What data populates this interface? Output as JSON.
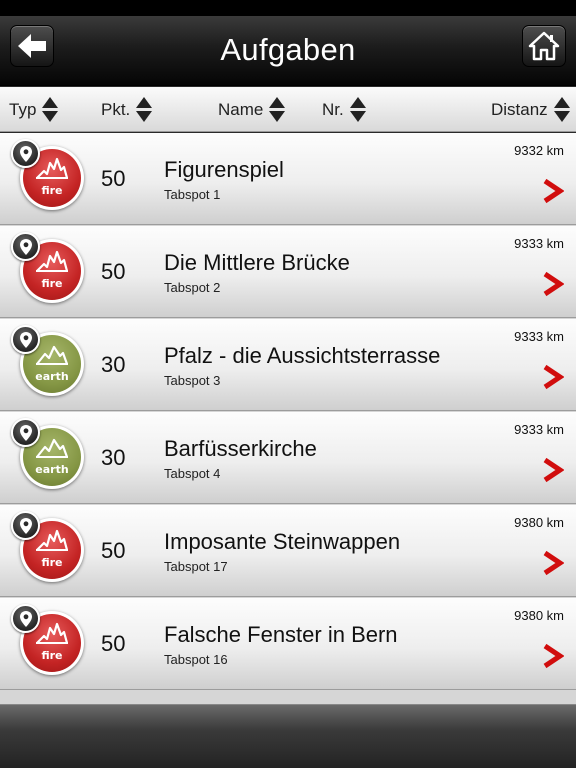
{
  "header": {
    "title": "Aufgaben",
    "back_icon": "arrow-left-icon",
    "home_icon": "home-icon"
  },
  "columns": {
    "type": "Typ",
    "points": "Pkt.",
    "name": "Name",
    "number": "Nr.",
    "distance": "Distanz"
  },
  "tasks": [
    {
      "element": "fire",
      "element_label": "fire",
      "points": "50",
      "title": "Figurenspiel",
      "subtitle": "Tabspot 1",
      "distance": "9332 km"
    },
    {
      "element": "fire",
      "element_label": "fire",
      "points": "50",
      "title": "Die Mittlere Brücke",
      "subtitle": "Tabspot 2",
      "distance": "9333 km"
    },
    {
      "element": "earth",
      "element_label": "earth",
      "points": "30",
      "title": "Pfalz - die Aussichtsterrasse",
      "subtitle": "Tabspot 3",
      "distance": "9333 km"
    },
    {
      "element": "earth",
      "element_label": "earth",
      "points": "30",
      "title": "Barfüsserkirche",
      "subtitle": "Tabspot 4",
      "distance": "9333 km"
    },
    {
      "element": "fire",
      "element_label": "fire",
      "points": "50",
      "title": "Imposante Steinwappen",
      "subtitle": "Tabspot 17",
      "distance": "9380 km"
    },
    {
      "element": "fire",
      "element_label": "fire",
      "points": "50",
      "title": "Falsche Fenster in Bern",
      "subtitle": "Tabspot 16",
      "distance": "9380 km"
    }
  ],
  "colors": {
    "chevron": "#d10d0d",
    "fire": "#c42424",
    "earth": "#859745"
  }
}
